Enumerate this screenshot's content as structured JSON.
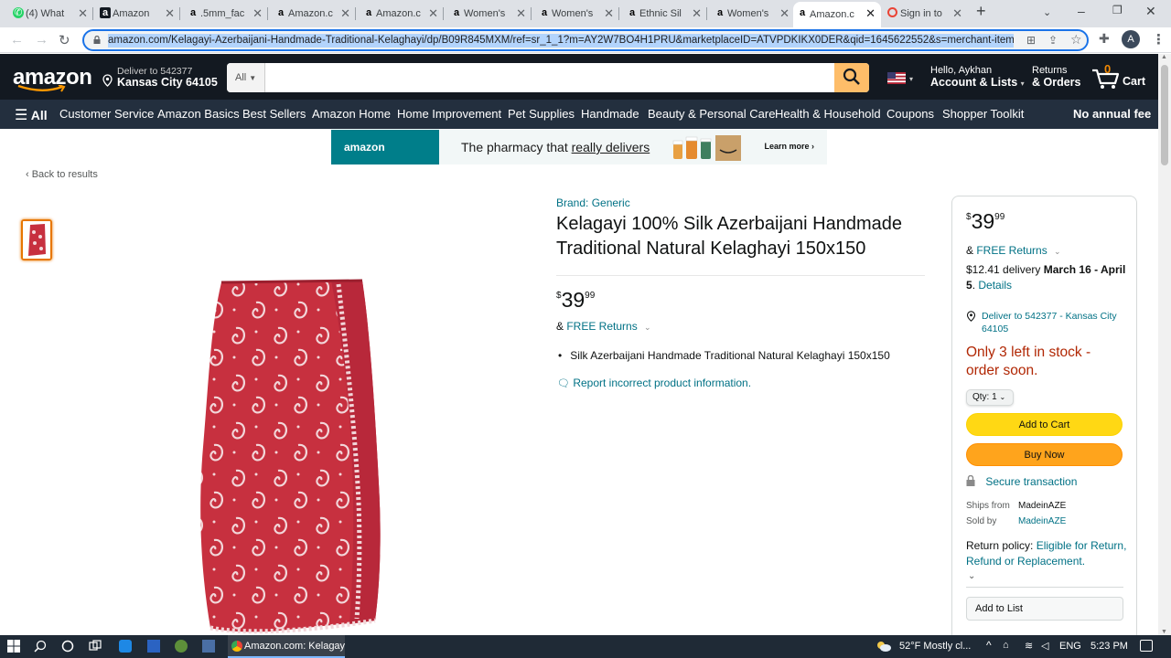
{
  "browser": {
    "tabs": [
      {
        "label": "(4) What",
        "icon": "whatsapp-icon"
      },
      {
        "label": "Amazon",
        "icon": "amazon-icon"
      },
      {
        "label": ".5mm_fac",
        "icon": "amazon-icon"
      },
      {
        "label": "Amazon.c",
        "icon": "amazon-icon"
      },
      {
        "label": "Amazon.c",
        "icon": "amazon-icon"
      },
      {
        "label": "Women's",
        "icon": "amazon-icon"
      },
      {
        "label": "Women's",
        "icon": "amazon-icon"
      },
      {
        "label": "Ethnic Sil",
        "icon": "amazon-icon"
      },
      {
        "label": "Women's",
        "icon": "amazon-icon"
      },
      {
        "label": "Amazon.c",
        "icon": "amazon-icon"
      },
      {
        "label": "Sign in to",
        "icon": "google-icon"
      }
    ],
    "url": "amazon.com/Kelagayi-Azerbaijani-Handmade-Traditional-Kelaghayi/dp/B09R845MXM/ref=sr_1_1?m=AY2W7BO4H1PRU&marketplaceID=ATVPDKIKX0DER&qid=1645622552&s=merchant-items",
    "profile_initial": "A"
  },
  "header": {
    "logo": "amazon",
    "deliver_line1": "Deliver to 542377",
    "deliver_line2": "Kansas City 64105",
    "search_category": "All",
    "search_placeholder": "",
    "hello": "Hello, Aykhan",
    "account": "Account & Lists",
    "returns": "Returns",
    "orders": "& Orders",
    "cart_count": "0",
    "cart": "Cart"
  },
  "nav": {
    "all": "All",
    "items": [
      "Customer Service",
      "Amazon Basics",
      "Best Sellers",
      "Amazon Home",
      "Home Improvement",
      "Pet Supplies",
      "Handmade",
      "Beauty & Personal Care",
      "Health & Household",
      "Coupons",
      "Shopper Toolkit"
    ],
    "promo": "No annual fee"
  },
  "banner": {
    "brand": "amazon pharmacy",
    "tagline_pre": "The pharmacy that ",
    "tagline_link": "really delivers",
    "learn": "Learn more ›"
  },
  "product": {
    "back": "‹ Back to results",
    "brand": "Brand: Generic",
    "title": "Kelagayi 100% Silk Azerbaijani Handmade Traditional Natural Kelaghayi 150x150",
    "price_symbol": "$",
    "price_whole": "39",
    "price_fraction": "99",
    "returns_prefix": "& ",
    "returns_link": "FREE Returns",
    "bullets": [
      "Silk Azerbaijani Handmade Traditional Natural Kelaghayi 150x150"
    ],
    "report": "Report incorrect product information."
  },
  "buybox": {
    "price_symbol": "$",
    "price_whole": "39",
    "price_fraction": "99",
    "returns_prefix": "& ",
    "returns_link": "FREE Returns",
    "delivery_pre": "$12.41 delivery ",
    "delivery_dates": "March 16 - April 5",
    "delivery_details": "Details",
    "deliver_to": "Deliver to 542377 - Kansas City 64105",
    "stock": "Only 3 left in stock - order soon.",
    "qty": "Qty: 1",
    "add_to_cart": "Add to Cart",
    "buy_now": "Buy Now",
    "secure": "Secure transaction",
    "ships_from_label": "Ships from",
    "ships_from": "MadeinAZE",
    "sold_by_label": "Sold by",
    "sold_by": "MadeinAZE",
    "return_policy_label": "Return policy: ",
    "return_policy_link": "Eligible for Return, Refund or Replacement.",
    "add_to_list": "Add to List"
  },
  "taskbar": {
    "active_app": "Amazon.com: Kelagay...",
    "weather": "52°F  Mostly cl...",
    "lang": "ENG",
    "time": "5:23 PM"
  },
  "colors": {
    "amazon_dark": "#131921",
    "amazon_nav": "#232f3e",
    "search_btn": "#febd69",
    "add_to_cart": "#ffd814",
    "buy_now": "#ffa41c",
    "stock_red": "#b12704",
    "link": "#007185",
    "scarf_red": "#c7303f"
  }
}
